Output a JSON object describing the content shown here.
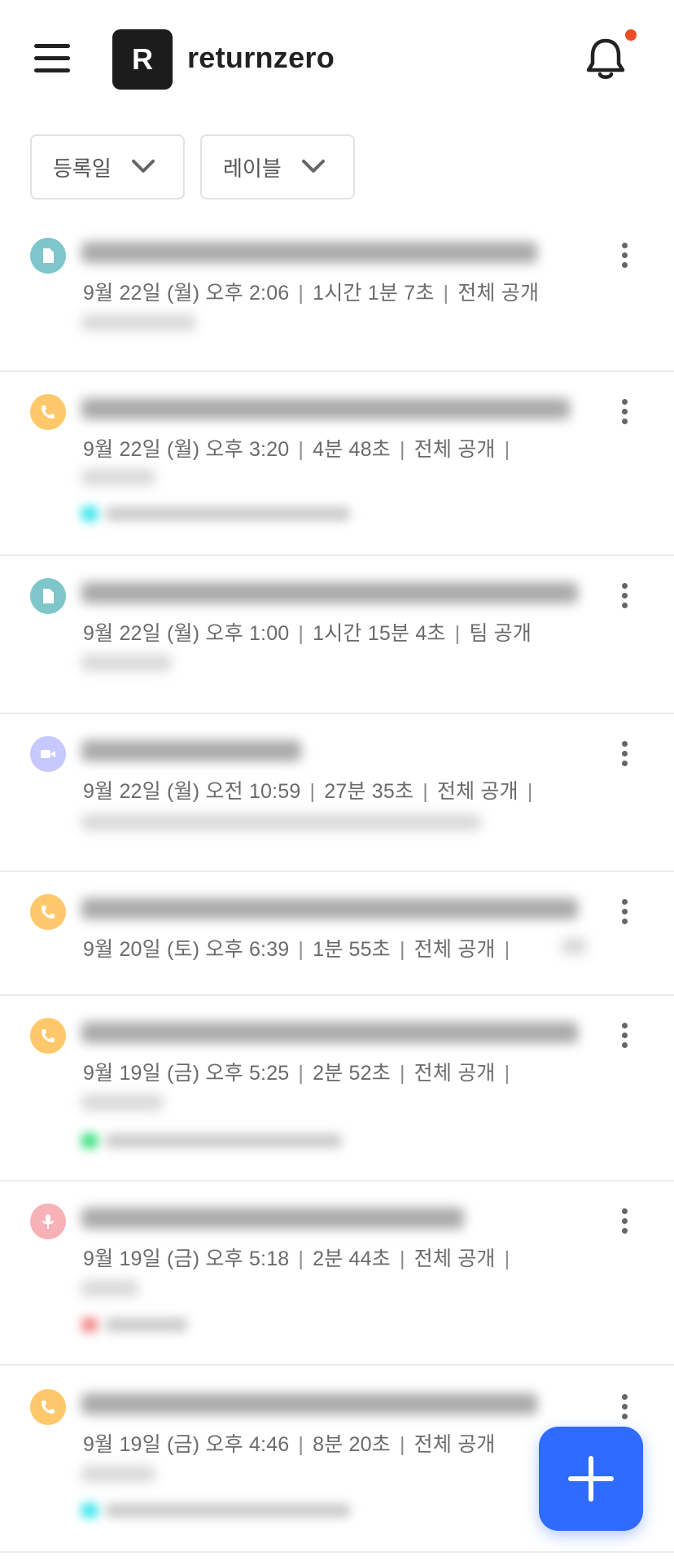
{
  "header": {
    "logo_letter": "R",
    "workspace_name": "returnzero",
    "menu_icon": "hamburger-icon",
    "notification_icon": "bell-icon",
    "notification_dot_color": "#ef4b24"
  },
  "filters": [
    {
      "label": "등록일",
      "icon": "chevron-down-icon"
    },
    {
      "label": "레이블",
      "icon": "chevron-down-icon"
    }
  ],
  "colors": {
    "doc": "#7ec6c9",
    "call": "#ffc86b",
    "video": "#c7c8ff",
    "mic": "#f7b2b8",
    "fab": "#2f6bff"
  },
  "items": [
    {
      "type": "document-icon",
      "date": "9월 22일 (월) 오후 2:06",
      "duration": "1시간 1분 7초",
      "visibility": "전체 공개",
      "trailing_sep": false
    },
    {
      "type": "phone-icon",
      "date": "9월 22일 (월) 오후 3:20",
      "duration": "4분 48초",
      "visibility": "전체 공개",
      "trailing_sep": true
    },
    {
      "type": "document-icon",
      "date": "9월 22일 (월) 오후 1:00",
      "duration": "1시간 15분 4초",
      "visibility": "팀 공개",
      "trailing_sep": false
    },
    {
      "type": "video-icon",
      "date": "9월 22일 (월) 오전 10:59",
      "duration": "27분 35초",
      "visibility": "전체 공개",
      "trailing_sep": true
    },
    {
      "type": "phone-icon",
      "date": "9월 20일 (토) 오후 6:39",
      "duration": "1분 55초",
      "visibility": "전체 공개",
      "trailing_sep": true
    },
    {
      "type": "phone-icon",
      "date": "9월 19일 (금) 오후 5:25",
      "duration": "2분 52초",
      "visibility": "전체 공개",
      "trailing_sep": true
    },
    {
      "type": "microphone-icon",
      "date": "9월 19일 (금) 오후 5:18",
      "duration": "2분 44초",
      "visibility": "전체 공개",
      "trailing_sep": true
    },
    {
      "type": "phone-icon",
      "date": "9월 19일 (금) 오후 4:46",
      "duration": "8분 20초",
      "visibility": "전체 공개",
      "trailing_sep": false
    }
  ],
  "fab": {
    "icon": "plus-icon"
  }
}
